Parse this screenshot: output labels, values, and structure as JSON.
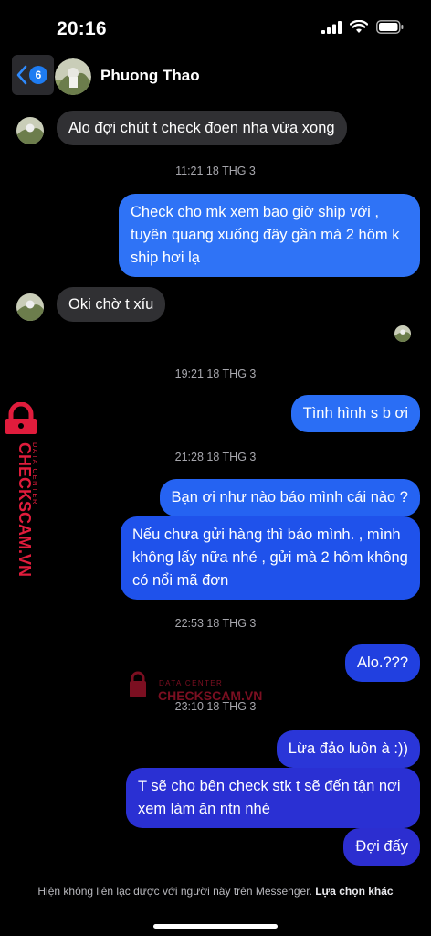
{
  "status_bar": {
    "time": "20:16"
  },
  "header": {
    "unread_count": "6",
    "contact_name": "Phuong Thao"
  },
  "messages": [
    {
      "side": "in",
      "text": "Alo đợi chút t check đoen nha vừa xong"
    },
    {
      "side": "ts",
      "text": "11:21 18 THG 3"
    },
    {
      "side": "out",
      "text": "Check cho mk xem bao giờ ship với , tuyên quang xuống đây gần mà 2 hôm k ship hơi lạ"
    },
    {
      "side": "in",
      "text": "Oki chờ t xíu"
    },
    {
      "side": "ts",
      "text": "19:21 18 THG 3"
    },
    {
      "side": "out",
      "text": "Tình hình s b ơi"
    },
    {
      "side": "ts",
      "text": "21:28 18 THG 3"
    },
    {
      "side": "out",
      "text": "Bạn ơi như nào báo mình cái nào ?"
    },
    {
      "side": "out",
      "text": "Nếu chưa gửi hàng thì báo mình. , mình không lấy nữa nhé , gửi mà 2 hôm không có nổi mã đơn"
    },
    {
      "side": "ts",
      "text": "22:53 18 THG 3"
    },
    {
      "side": "out",
      "text": "Alo.???"
    },
    {
      "side": "ts",
      "text": "23:10 18 THG 3"
    },
    {
      "side": "out",
      "text": "Lừa đảo luôn à :))"
    },
    {
      "side": "out",
      "text": "T sẽ cho bên check stk t sẽ đến tận nơi xem làm ăn ntn nhé"
    },
    {
      "side": "out",
      "text": "Đợi đấy"
    }
  ],
  "watermark": {
    "brand": "CHECKSCAM.VN",
    "tagline": "DATA CENTER"
  },
  "footer": {
    "notice": "Hiện không liên lạc được với người này trên Messenger.",
    "link": "Lựa chọn khác"
  },
  "colors": {
    "bubble_out_top": "#2f6ff4",
    "bubble_out_mid": "#1f4ee8",
    "bubble_out_bottom": "#2a32d6",
    "bubble_in": "#303033",
    "badge": "#1e7cf2",
    "watermark": "#e01c3c"
  }
}
